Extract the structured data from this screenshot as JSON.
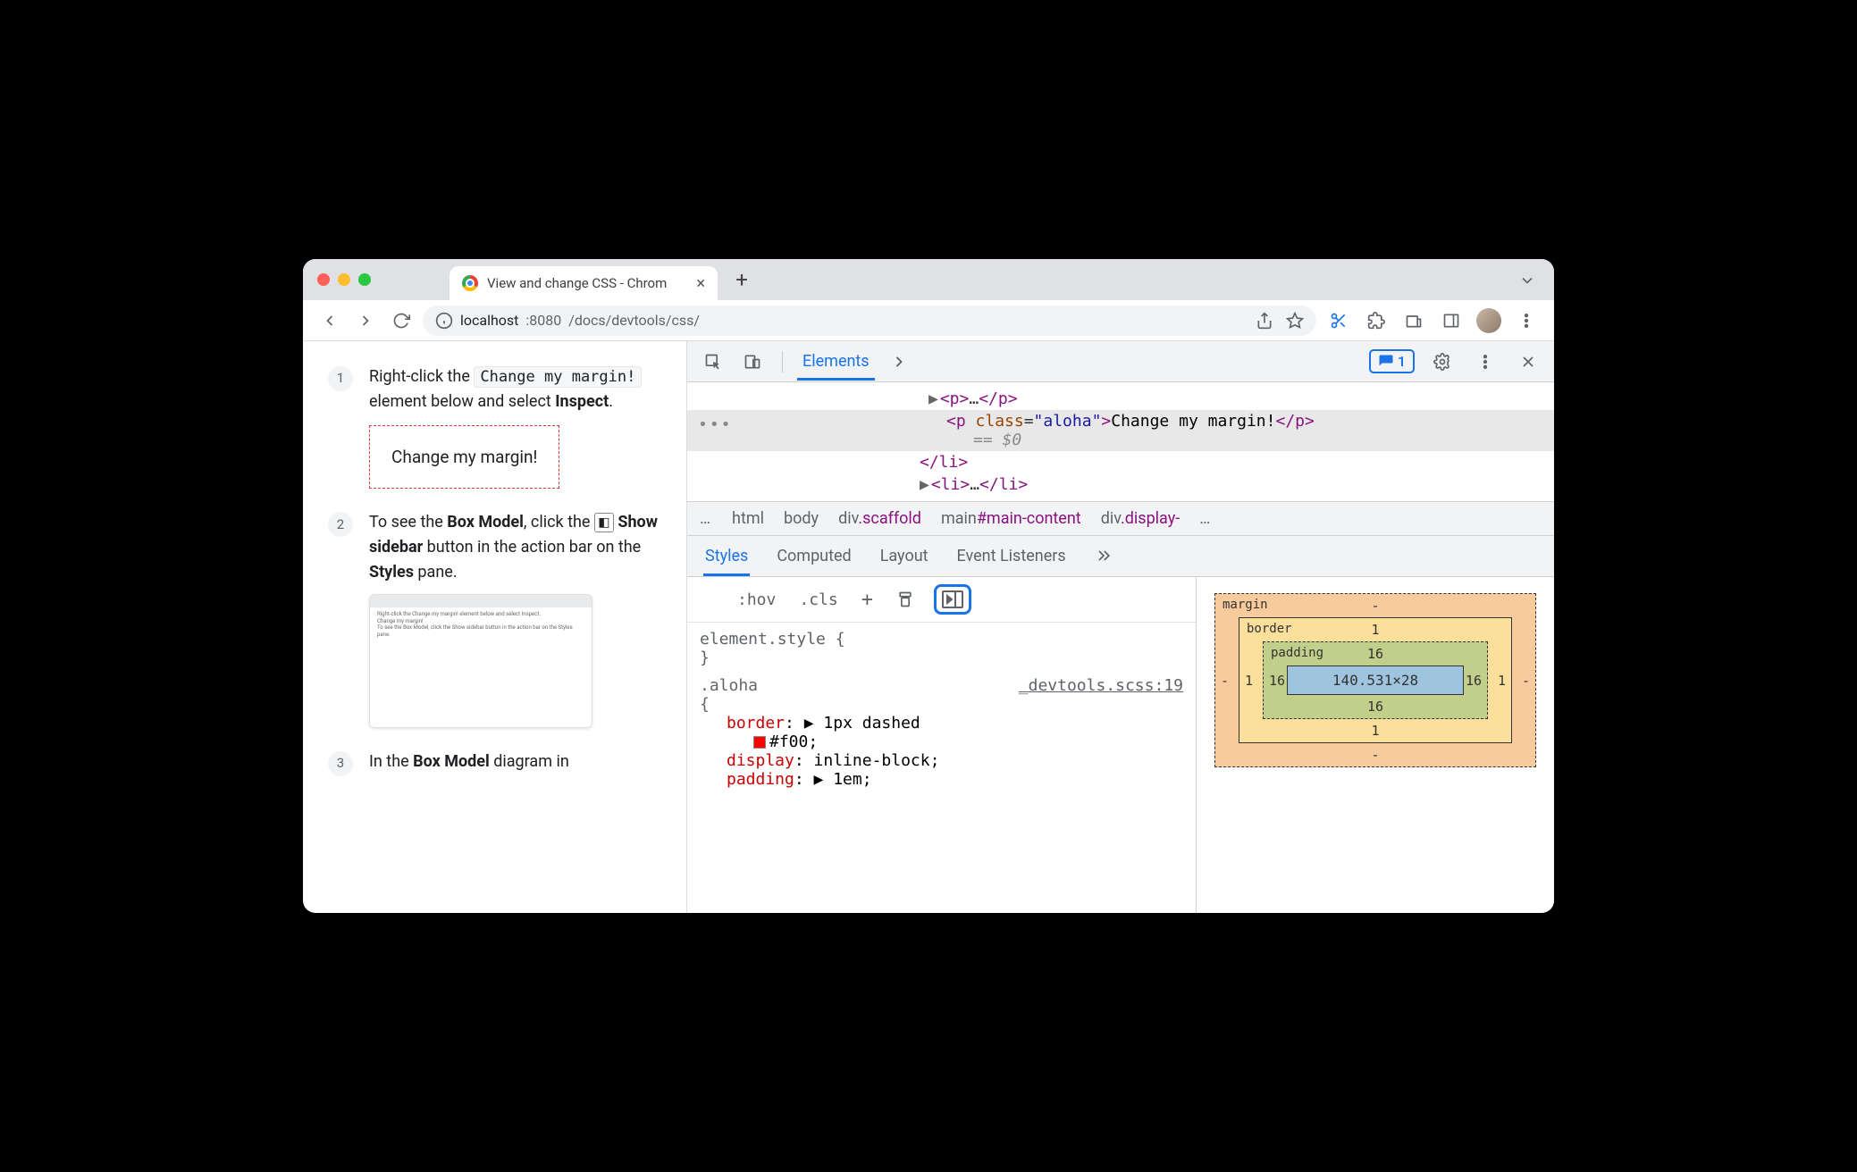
{
  "browser": {
    "tab_title": "View and change CSS - Chrom",
    "url_prefix": "localhost",
    "url_port": ":8080",
    "url_path": "/docs/devtools/css/"
  },
  "page": {
    "step1_a": "Right-click the ",
    "step1_code": "Change my margin!",
    "step1_b": " element below and select ",
    "step1_bold": "Inspect",
    "step1_c": ".",
    "target_text": "Change my margin!",
    "step2_a": "To see the ",
    "step2_bold1": "Box Model",
    "step2_b": ", click the ",
    "step2_bold2": "Show sidebar",
    "step2_c": " button in the action bar on the ",
    "step2_bold3": "Styles",
    "step2_d": " pane.",
    "step3_a": "In the ",
    "step3_bold": "Box Model",
    "step3_b": " diagram in"
  },
  "devtools": {
    "tabs": {
      "elements": "Elements"
    },
    "issue_count": "1",
    "dom": {
      "line1": "<p>…</p>",
      "sel_open": "<p ",
      "sel_attr": "class",
      "sel_eq": "=",
      "sel_val": "\"aloha\"",
      "sel_close": ">",
      "sel_text": "Change my margin!",
      "sel_end": "</p>",
      "eq0": "== $0",
      "line3": "</li>",
      "line4": "<li>…</li>"
    },
    "crumbs": {
      "c1": "html",
      "c2": "body",
      "c3a": "div",
      "c3b": ".scaffold",
      "c4a": "main",
      "c4b": "#main-content",
      "c5a": "div",
      "c5b": ".display-"
    },
    "styles_tabs": {
      "styles": "Styles",
      "computed": "Computed",
      "layout": "Layout",
      "listeners": "Event Listeners"
    },
    "actions": {
      "hov": ":hov",
      "cls": ".cls"
    },
    "rules": {
      "elstyle": "element.style {",
      "elstyle_close": "}",
      "sel": ".aloha {",
      "src": "_devtools.scss:19",
      "p1n": "border",
      "p1v": "1px dashed",
      "p1v2": "#f00",
      "p2n": "display",
      "p2v": "inline-block",
      "p3n": "padding",
      "p3v": "1em"
    },
    "box": {
      "margin_label": "margin",
      "border_label": "border",
      "padding_label": "padding",
      "content": "140.531×28",
      "m": "-",
      "b": "1",
      "p": "16"
    }
  }
}
